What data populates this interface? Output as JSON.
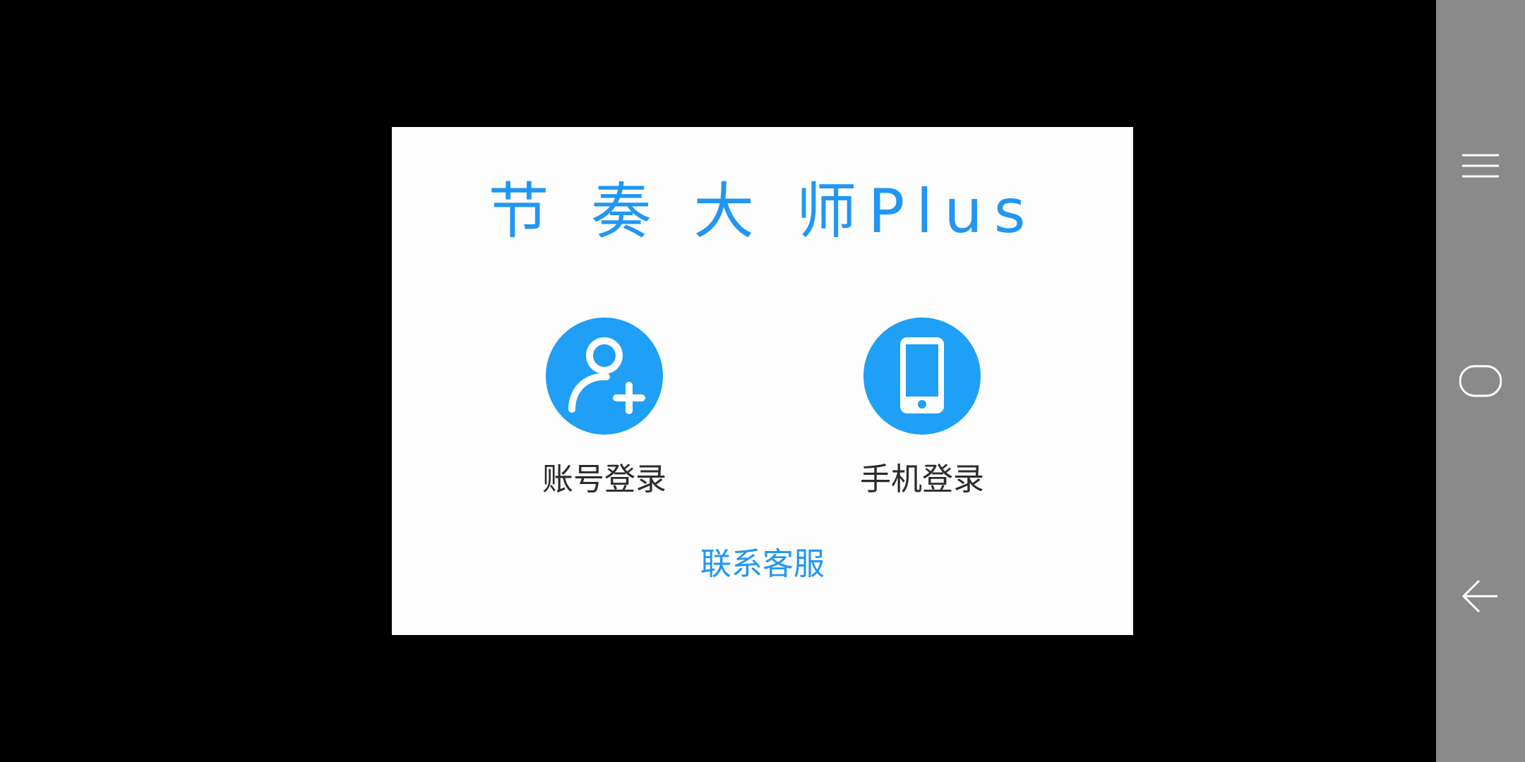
{
  "dialog": {
    "title": "节 奏 大 师Plus",
    "options": [
      {
        "label": "账号登录",
        "icon": "user-add-icon"
      },
      {
        "label": "手机登录",
        "icon": "mobile-phone-icon"
      }
    ],
    "contact_label": "联系客服"
  },
  "navbar": {
    "buttons": [
      {
        "icon": "menu-icon"
      },
      {
        "icon": "home-icon"
      },
      {
        "icon": "back-arrow-icon"
      }
    ]
  },
  "colors": {
    "accent": "#2196f3",
    "icon_circle": "#1f9ff6",
    "dialog_bg": "#fdfdfd",
    "navbar_bg": "#8a8a8a",
    "screen_bg": "#000000"
  }
}
